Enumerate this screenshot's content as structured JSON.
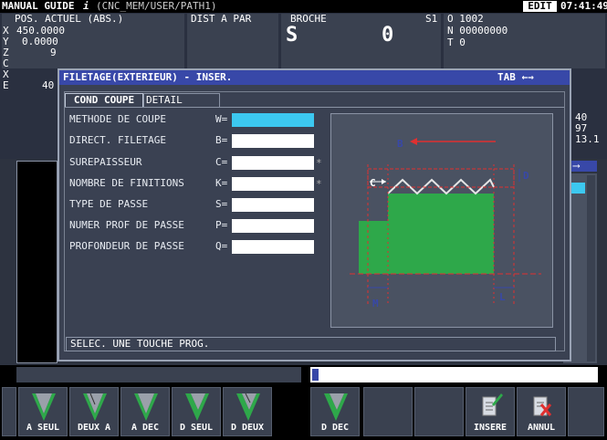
{
  "header": {
    "title": "MANUAL GUIDE",
    "title_glyph": "i",
    "path": "(CNC_MEM/USER/PATH1)",
    "mode": "EDIT",
    "clock": "07:41:49"
  },
  "position": {
    "label": "POS. ACTUEL (ABS.)",
    "dist_label": "DIST A PAR",
    "axes": [
      {
        "axis": "X",
        "value": "450.0000"
      },
      {
        "axis": "Y",
        "value": "0.0000"
      },
      {
        "axis": "Z",
        "value": "9"
      },
      {
        "axis": "C",
        "value": ""
      },
      {
        "axis": "X",
        "value": ""
      },
      {
        "axis": "E",
        "value": "40"
      }
    ]
  },
  "spindle": {
    "label": "BROCHE",
    "s_label": "S1",
    "s_letter": "S",
    "s_value": "0"
  },
  "program": {
    "o_line": "O 1002",
    "n_line": "N 00000000",
    "t_line": "T 0"
  },
  "right_values": [
    "40",
    "97",
    "13.1"
  ],
  "dialog": {
    "title": "FILETAGE(EXTERIEUR) - INSER.",
    "tab_hint": "TAB ←→",
    "tabs": [
      "COND COUPE",
      "DETAIL"
    ],
    "fields": [
      {
        "label": "METHODE DE COUPE",
        "key": "W=",
        "star": ""
      },
      {
        "label": "DIRECT.  FILETAGE",
        "key": "B=",
        "star": ""
      },
      {
        "label": "SUREPAISSEUR",
        "key": "C=",
        "star": "*"
      },
      {
        "label": "NOMBRE DE FINITIONS",
        "key": "K=",
        "star": "*"
      },
      {
        "label": "TYPE DE PASSE",
        "key": "S=",
        "star": ""
      },
      {
        "label": "NUMER PROF DE PASSE",
        "key": "P=",
        "star": ""
      },
      {
        "label": "PROFONDEUR DE PASSE",
        "key": "Q=",
        "star": ""
      }
    ],
    "diagram_labels": {
      "b": "B",
      "c": "C",
      "d": "D",
      "m": "M",
      "l": "L"
    },
    "status": "SELEC. UNE TOUCHE PROG."
  },
  "softkeys": [
    {
      "label": "A SEUL"
    },
    {
      "label": "DEUX A"
    },
    {
      "label": "A DEC"
    },
    {
      "label": "D SEUL"
    },
    {
      "label": "D DEUX"
    },
    {
      "label": "D DEC"
    },
    {
      "label": ""
    },
    {
      "label": ""
    },
    {
      "label": "INSERE"
    },
    {
      "label": "ANNUL"
    },
    {
      "label": ""
    }
  ],
  "colors": {
    "active_field": "#3cc8f0",
    "title_bar": "#3848a8",
    "green": "#2ea84a",
    "red": "#e03030"
  }
}
